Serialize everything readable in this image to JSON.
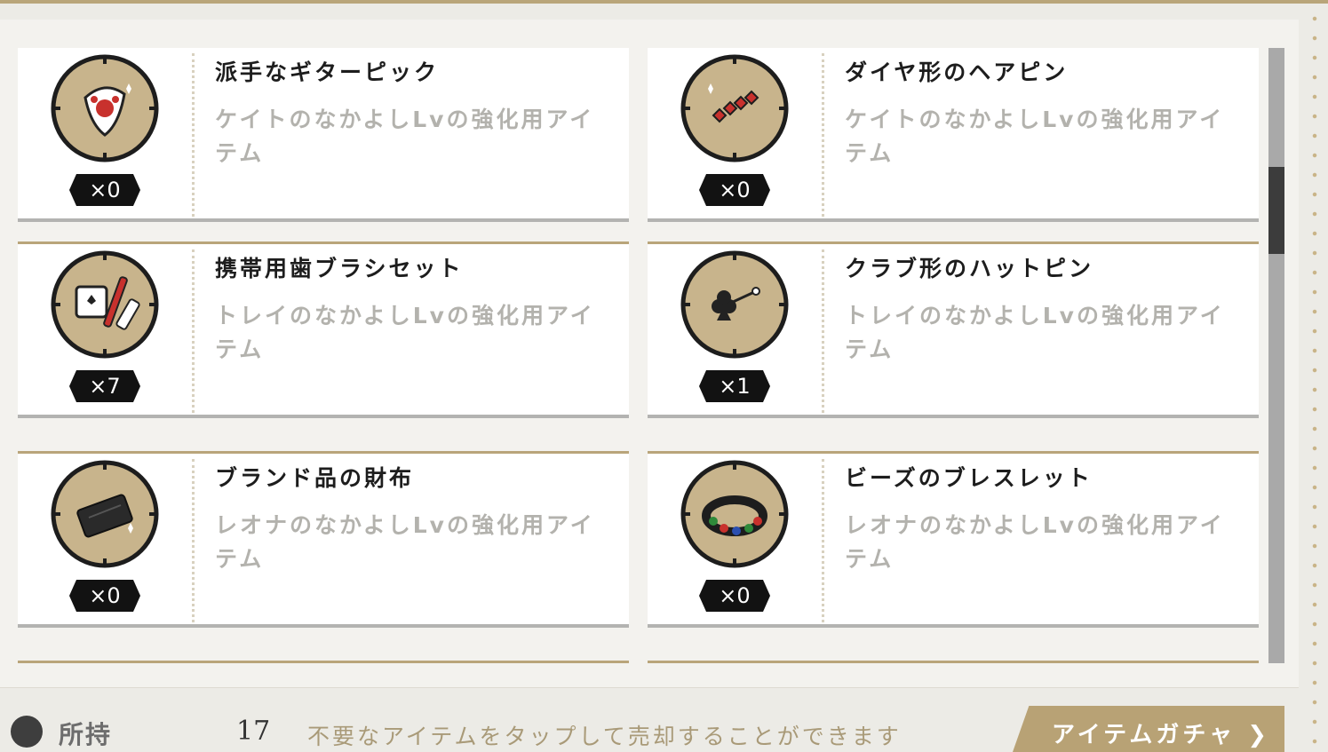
{
  "items": [
    {
      "name": "派手なギターピック",
      "desc": "ケイトのなかよしLvの強化用アイテム",
      "qty": "×0",
      "icon": "guitar-pick-icon"
    },
    {
      "name": "ダイヤ形のヘアピン",
      "desc": "ケイトのなかよしLvの強化用アイテム",
      "qty": "×0",
      "icon": "hairpin-icon"
    },
    {
      "name": "携帯用歯ブラシセット",
      "desc": "トレイのなかよしLvの強化用アイテム",
      "qty": "×7",
      "icon": "toothbrush-set-icon"
    },
    {
      "name": "クラブ形のハットピン",
      "desc": "トレイのなかよしLvの強化用アイテム",
      "qty": "×1",
      "icon": "hatpin-icon"
    },
    {
      "name": "ブランド品の財布",
      "desc": "レオナのなかよしLvの強化用アイテム",
      "qty": "×0",
      "icon": "wallet-icon"
    },
    {
      "name": "ビーズのブレスレット",
      "desc": "レオナのなかよしLvの強化用アイテム",
      "qty": "×0",
      "icon": "bracelet-icon"
    }
  ],
  "footer": {
    "label": "所持",
    "count": "17",
    "hint": "不要なアイテムをタップして売却することができます",
    "gacha_button": "アイテムガチャ ❯"
  },
  "colors": {
    "accent_gold": "#b9a57a",
    "qty_badge": "#121212",
    "desc_text": "#b3b2ad"
  }
}
